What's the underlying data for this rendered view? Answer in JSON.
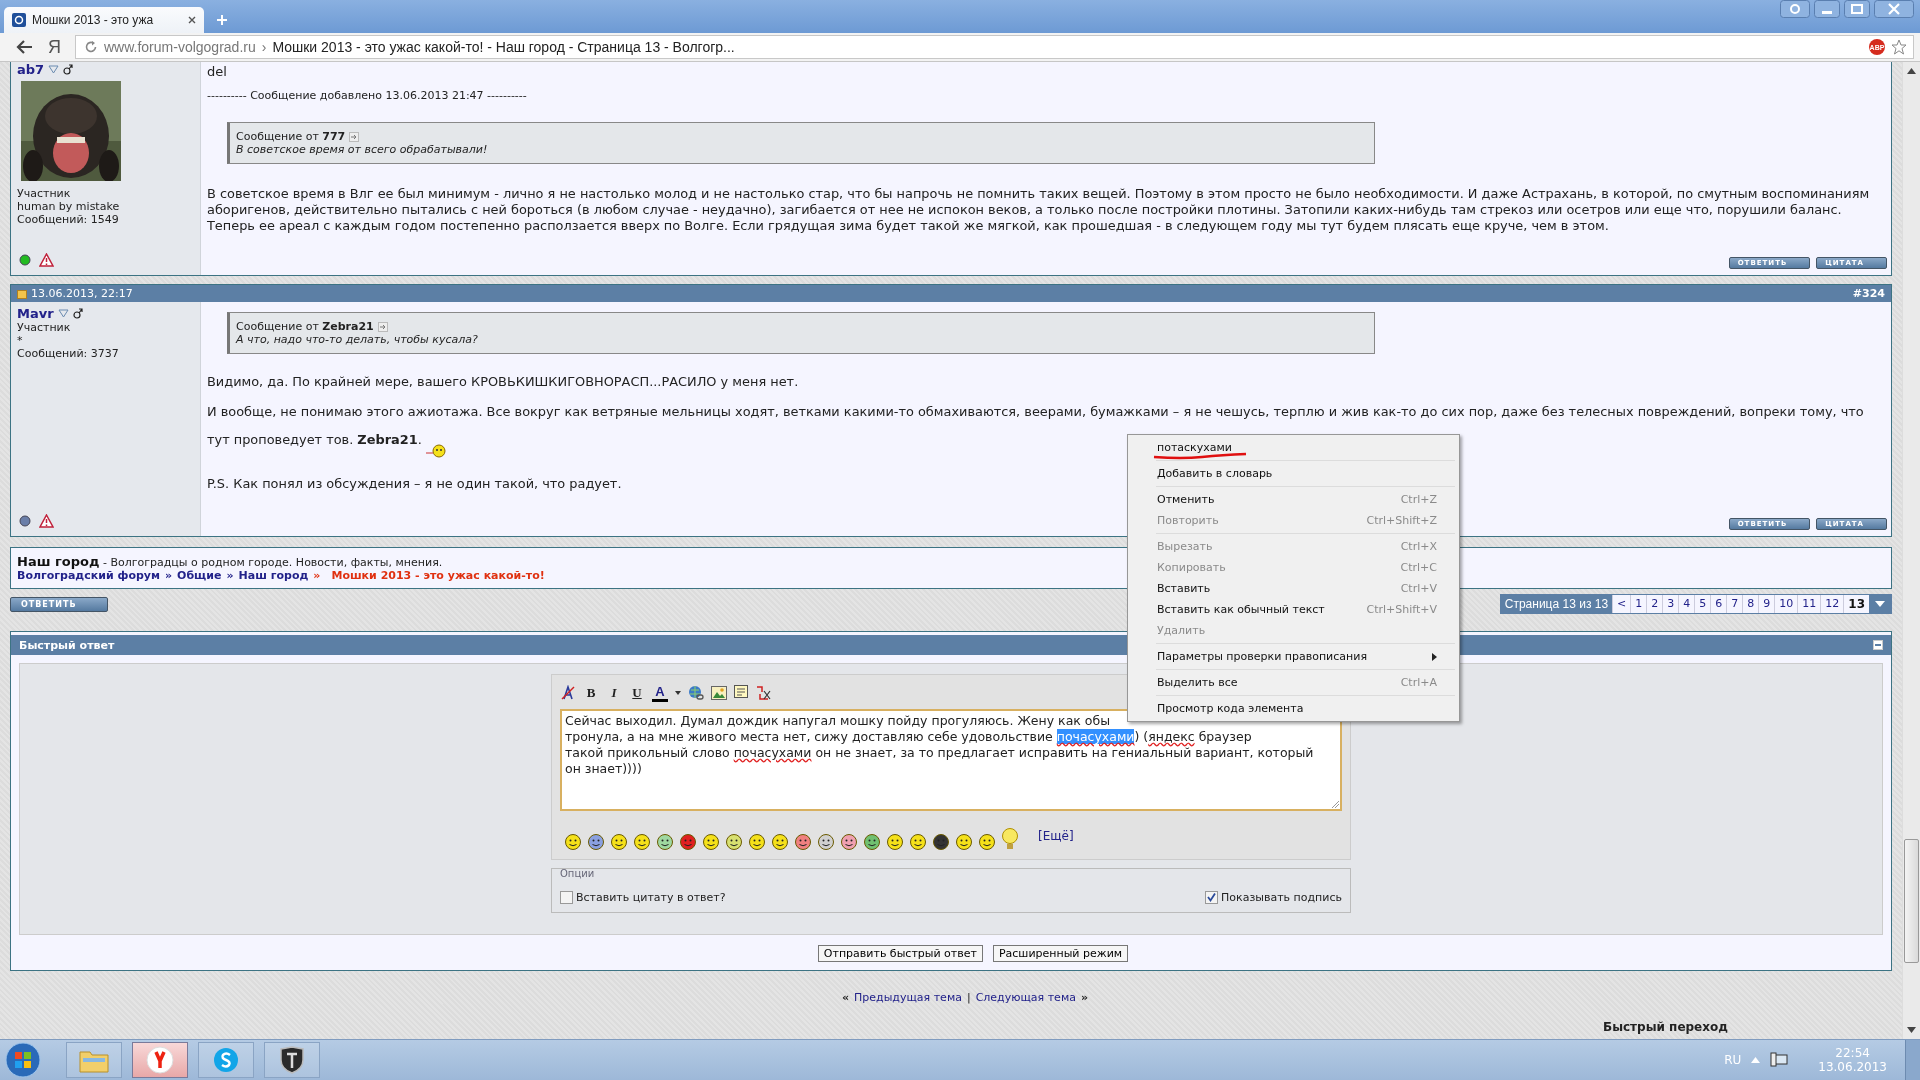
{
  "browser": {
    "tab_title": "Мошки 2013 - это ужа",
    "yandex_button": "Я",
    "address_domain": "www.forum-volgograd.ru",
    "address_separator": "›",
    "address_title": "Мошки 2013 - это ужас какой-то! - Наш город - Страница 13 - Волгогр...",
    "adblock_label": "ABP"
  },
  "posts": [
    {
      "author": "ab7",
      "rank": "Участник",
      "user_title": "human by mistake",
      "posts_count": "Сообщений: 1549",
      "online": true,
      "avatar": {
        "kind": "picture"
      },
      "lead": "del",
      "added_note": "---------- Сообщение добавлено 13.06.2013 21:47 ----------",
      "quote": {
        "from_label": "Сообщение от",
        "author": "777",
        "text": "В советское время от всего обрабатывали!"
      },
      "paragraphs": [
        {
          "text": "В советское время в Влг ее был минимум - лично я не настолько молод и не настолько стар, что бы напрочь не помнить таких вещей. Поэтому в этом просто не было необходимости. И даже Астрахань, в которой, по смутным воспоминаниям аборигенов, действительно пытались с ней бороться (в любом случае - неудачно), загибается от нее не испокон веков, а только после постройки плотины. Затопили каких-нибудь там стрекоз или осетров или еще что, порушили баланс. Теперь ее ареал с каждым годом постепенно расползается вверх по Волге. Если грядущая зима будет такой же мягкой, как прошедшая - в следующем году мы тут будем плясать еще круче, чем в этом."
        }
      ],
      "reply_label": "ОТВЕТИТЬ",
      "quote_label": "ЦИТАТА"
    },
    {
      "header": {
        "date": "13.06.2013, 22:17",
        "number": "#324"
      },
      "author": "Mavr",
      "rank": "Участник",
      "user_title": "*",
      "posts_count": "Сообщений: 3737",
      "online": false,
      "quote": {
        "from_label": "Сообщение от",
        "author": "Zebra21",
        "text": "А что, надо что-то делать, чтобы кусала?"
      },
      "paragraphs": [
        {
          "text": "Видимо, да. По крайней мере, вашего КРОВЬКИШКИГОВНОРАСП...РАСИЛО у меня нет."
        },
        {
          "text": "И вообще, не понимаю этого ажиотажа. Все вокруг как ветряные мельницы ходят, ветками какими-то обмахиваются, веерами, бумажками – я не чешусь, терплю и жив как-то до сих пор, даже без телесных повреждений, вопреки тому, что тут проповедует тов. **Zebra21**.",
          "smiley": true
        },
        {
          "text": "P.S. Как понял из обсуждения – я не один такой, что радует."
        }
      ],
      "reply_label": "ОТВЕТИТЬ",
      "quote_label": "ЦИТАТА"
    }
  ],
  "breadcrumb": {
    "forum": "Наш город",
    "description": " - Волгоградцы о родном городе. Новости, факты, мнения.",
    "crumbs": [
      "Волгоградский форум",
      "Общие",
      "Наш город"
    ],
    "separator": "»",
    "current": "Мошки 2013 - это ужас какой-то!"
  },
  "reply_button": "ОТВЕТИТЬ",
  "pagination": {
    "label": "Страница 13 из 13",
    "prev": "<",
    "pages": [
      {
        "label": "1",
        "selected": false
      },
      {
        "label": "2",
        "selected": false
      },
      {
        "label": "3",
        "selected": false
      },
      {
        "label": "4",
        "selected": false
      },
      {
        "label": "5",
        "selected": false
      },
      {
        "label": "6",
        "selected": false
      },
      {
        "label": "7",
        "selected": false
      },
      {
        "label": "8",
        "selected": false
      },
      {
        "label": "9",
        "selected": false
      },
      {
        "label": "10",
        "selected": false
      },
      {
        "label": "11",
        "selected": false
      },
      {
        "label": "12",
        "selected": false
      },
      {
        "label": "13",
        "selected": true
      }
    ]
  },
  "quick_reply": {
    "title": "Быстрый ответ",
    "toolbar": {
      "bold": "B",
      "italic": "I",
      "underline": "U",
      "font_color": "A"
    },
    "text_lines": [
      [
        {
          "kind": "plain",
          "text": "Сейчас выходил. Думал дождик напугал мошку пойду прогуляюсь. Жену как обы"
        }
      ],
      [
        {
          "kind": "plain",
          "text": "тронула, а на мне живого места нет, сижу доставляю себе удовольствие "
        },
        {
          "kind": "selected",
          "text": "почасухами"
        },
        {
          "kind": "plain",
          "text": ")   ("
        },
        {
          "kind": "misspelled",
          "text": "яндекс"
        },
        {
          "kind": "plain",
          "text": " браузер"
        }
      ],
      [
        {
          "kind": "plain",
          "text": "такой прикольный слово "
        },
        {
          "kind": "misspelled",
          "text": "почасухами"
        },
        {
          "kind": "plain",
          "text": " он не знает, за то предлагает исправить на гениальный вариант, который"
        }
      ],
      [
        {
          "kind": "plain",
          "text": "он знает))))"
        }
      ]
    ],
    "more_smilies": "[Ещё]",
    "options_legend": "Опции",
    "options": [
      {
        "label": "Вставить цитату в ответ?",
        "checked": false
      },
      {
        "label": "Показывать подпись",
        "checked": true
      }
    ],
    "buttons": [
      "Отправить быстрый ответ",
      "Расширенный режим"
    ]
  },
  "thread_nav": {
    "prev_mark": "«",
    "prev": "Предыдущая тема",
    "divider": "|",
    "next": "Следующая тема",
    "next_mark": "»"
  },
  "quick_jump": "Быстрый переход",
  "context_menu": [
    {
      "kind": "suggestion",
      "label": "потаскухами",
      "disabled": false
    },
    {
      "kind": "separator"
    },
    {
      "kind": "item",
      "label": "Добавить в словарь",
      "disabled": false
    },
    {
      "kind": "separator"
    },
    {
      "kind": "item",
      "label": "Отменить",
      "shortcut": "Ctrl+Z",
      "disabled": false
    },
    {
      "kind": "item",
      "label": "Повторить",
      "shortcut": "Ctrl+Shift+Z",
      "disabled": true
    },
    {
      "kind": "separator"
    },
    {
      "kind": "item",
      "label": "Вырезать",
      "shortcut": "Ctrl+X",
      "disabled": true
    },
    {
      "kind": "item",
      "label": "Копировать",
      "shortcut": "Ctrl+C",
      "disabled": true
    },
    {
      "kind": "item",
      "label": "Вставить",
      "shortcut": "Ctrl+V",
      "disabled": false
    },
    {
      "kind": "item",
      "label": "Вставить как обычный текст",
      "shortcut": "Ctrl+Shift+V",
      "disabled": false
    },
    {
      "kind": "item",
      "label": "Удалить",
      "disabled": true
    },
    {
      "kind": "separator"
    },
    {
      "kind": "submenu",
      "label": "Параметры проверки правописания",
      "disabled": false
    },
    {
      "kind": "separator"
    },
    {
      "kind": "item",
      "label": "Выделить все",
      "shortcut": "Ctrl+A",
      "disabled": false
    },
    {
      "kind": "separator"
    },
    {
      "kind": "item",
      "label": "Просмотр кода элемента",
      "disabled": false
    }
  ],
  "taskbar": {
    "apps": [
      {
        "kind": "explorer",
        "selected": false
      },
      {
        "kind": "yandex",
        "selected": true
      },
      {
        "kind": "skype",
        "selected": false
      },
      {
        "kind": "tanks",
        "selected": false
      }
    ],
    "language": "RU",
    "time": "22:54",
    "date": "13.06.2013"
  }
}
